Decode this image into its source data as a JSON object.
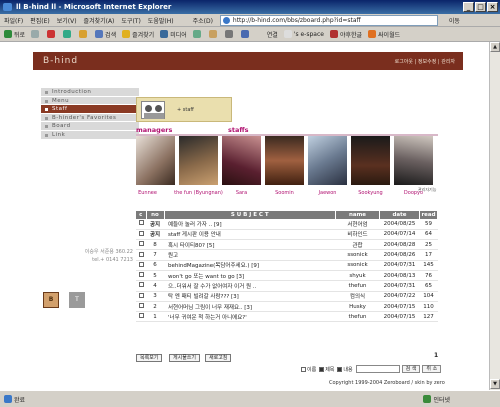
{
  "window": {
    "title": "ll B-hind ll - Microsoft Internet Explorer"
  },
  "menu": [
    "파일(F)",
    "편집(E)",
    "보기(V)",
    "즐겨찾기(A)",
    "도구(T)",
    "도움말(H)"
  ],
  "address": {
    "label": "주소(D)",
    "url": "http://b-hind.com/bbs/zboard.php?id=staff",
    "go": "이동"
  },
  "toolbar": {
    "back": "뒤로",
    "search": "검색",
    "favorites": "즐겨찾기",
    "media": "미디어",
    "links": "연결",
    "link1": "'s e-space",
    "link2": "야후한글",
    "link3": "싸이월드"
  },
  "status": {
    "left": "완료",
    "zone": "인터넷"
  },
  "site": {
    "logo": "B-hind",
    "login": "로그아웃",
    "info": "정보수정",
    "admin": "관리자",
    "nav": [
      "Introduction",
      "Menu",
      "Staff",
      "B-hinder's Favorites",
      "Board",
      "Link"
    ],
    "side_text1": "이승우 서준용 360.22",
    "side_text2": "tel.+ 0141 7213",
    "btn_b": "B",
    "btn_t": "T",
    "banner": "+ staff",
    "managers": "managers",
    "staffs": "staffs",
    "sidenote": "관리자기능",
    "names": [
      "Eunnee",
      "the fun (Byungnan)",
      "Sara",
      "Soomin",
      "Jaewon",
      "Sookyung",
      "Doopyo"
    ],
    "cols": [
      "c",
      "no",
      "S U B J E C T",
      "name",
      "date",
      "read"
    ],
    "rows": [
      {
        "no": "공지",
        "subject": "예들아 놀러 가자 .. [9]",
        "name": "서현어엄",
        "date": "2004/08/25",
        "read": "59"
      },
      {
        "no": "공지",
        "subject": "staff 게시판 이용 안내",
        "name": "비하인드",
        "date": "2004/07/14",
        "read": "64"
      },
      {
        "no": "8",
        "subject": "혹시 타이티80? [5]",
        "name": "관합",
        "date": "2004/08/28",
        "read": "25"
      },
      {
        "no": "7",
        "subject": "뭔고",
        "name": "ssonick",
        "date": "2004/08/26",
        "read": "17"
      },
      {
        "no": "6",
        "subject": "behindMagazine(목담어주세요.) [9]",
        "name": "ssonick",
        "date": "2004/07/31",
        "read": "145"
      },
      {
        "no": "5",
        "subject": "won't go 또는 want to go [3]",
        "name": "shyuk",
        "date": "2004/08/13",
        "read": "76"
      },
      {
        "no": "4",
        "subject": "으..더워서 잘 수가 없어여자 이거 원 ..",
        "name": "thefun",
        "date": "2004/07/31",
        "read": "65"
      },
      {
        "no": "3",
        "subject": "탁 엔 패티 빌려갈 사람??? [3]",
        "name": "컴의식",
        "date": "2004/07/22",
        "read": "104"
      },
      {
        "no": "2",
        "subject": "서현어머님 그림이 너무 재재요.. [3]",
        "name": "Husky",
        "date": "2004/07/15",
        "read": "110"
      },
      {
        "no": "1",
        "subject": "'너무 귀여운 척 하는거 아니에요?'",
        "name": "thefun",
        "date": "2004/07/15",
        "read": "127"
      }
    ],
    "buttons": [
      "목록보기",
      "게시물쓰기",
      "새로고침"
    ],
    "page": "1",
    "search_opts": [
      "이름",
      "제목",
      "내용"
    ],
    "search_btn": "검 색",
    "cancel_btn": "취 소",
    "copyright": "Copyright 1999-2004 Zeroboard / skin by zero"
  }
}
